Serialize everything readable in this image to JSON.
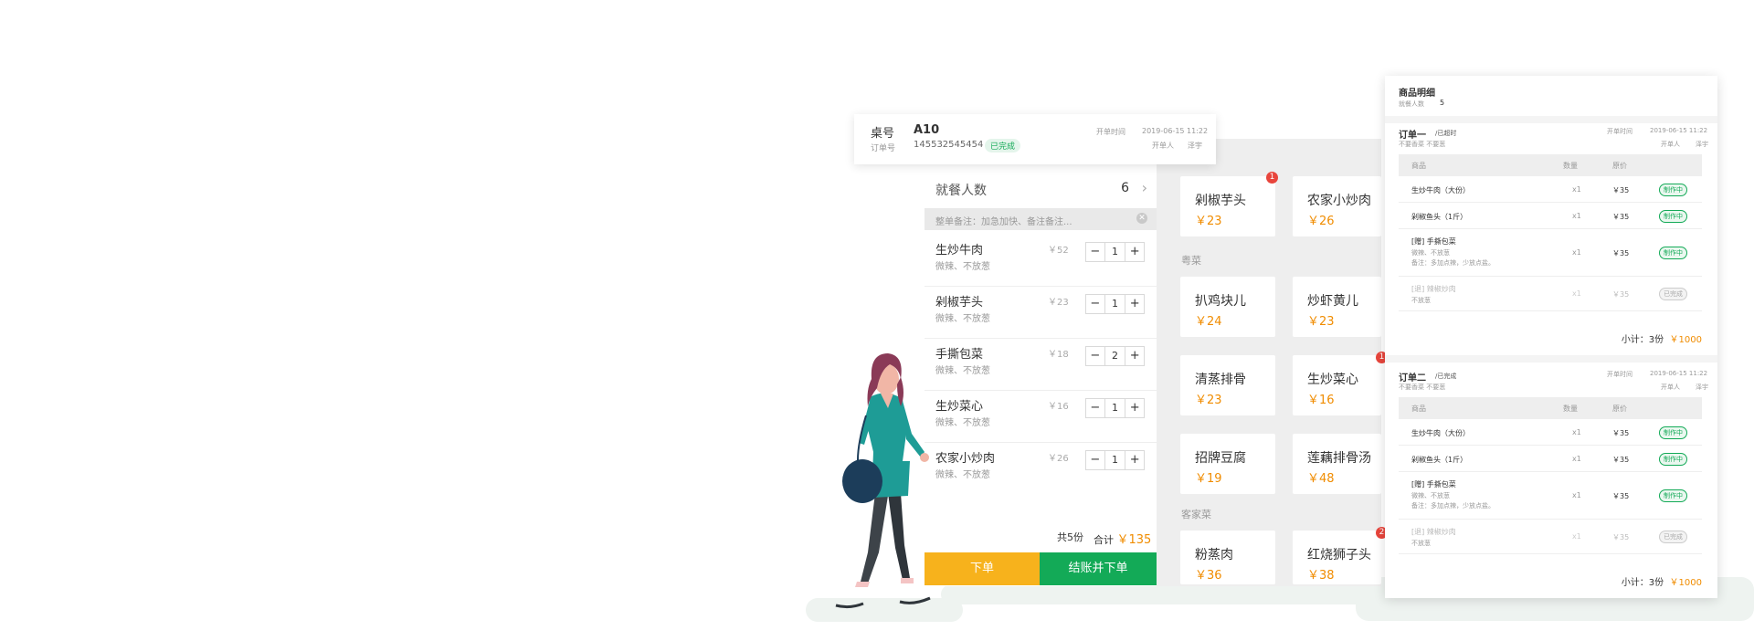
{
  "table_card": {
    "table_label": "桌号",
    "table_no": "A10",
    "order_label": "订单号",
    "order_no": "145532545454",
    "status": "已完成",
    "open_time_label": "开单时间",
    "open_time": "2019-06-15  11:22",
    "opener_label": "开单人",
    "opener": "泽宇"
  },
  "cart": {
    "diners_label": "就餐人数",
    "diners": "6",
    "remark_placeholder": "整单备注：加急加快、备注备注...",
    "items": [
      {
        "name": "生炒牛肉",
        "note": "微辣、不放葱",
        "price": "￥52",
        "qty": "1"
      },
      {
        "name": "剁椒芋头",
        "note": "微辣、不放葱",
        "price": "￥23",
        "qty": "1"
      },
      {
        "name": "手撕包菜",
        "note": "微辣、不放葱",
        "price": "￥18",
        "qty": "2"
      },
      {
        "name": "生炒菜心",
        "note": "微辣、不放葱",
        "price": "￥16",
        "qty": "1"
      },
      {
        "name": "农家小炒肉",
        "note": "微辣、不放葱",
        "price": "￥26",
        "qty": "1"
      }
    ],
    "count_text": "共5份",
    "total_label": "合计",
    "total": "￥135",
    "order_button": "下单",
    "pay_button": "结账并下单"
  },
  "menu": {
    "dishes_top": [
      {
        "name": "剁椒芋头",
        "price": "￥23",
        "badge": "1"
      },
      {
        "name": "农家小炒肉",
        "price": "￥26"
      }
    ],
    "cat_yue": "粤菜",
    "dishes_yue": [
      {
        "name": "扒鸡块儿",
        "price": "￥24"
      },
      {
        "name": "炒虾黄儿",
        "price": "￥23"
      },
      {
        "name": "清蒸排骨",
        "price": "￥23"
      },
      {
        "name": "生炒菜心",
        "price": "￥16",
        "badge": "1"
      },
      {
        "name": "招牌豆腐",
        "price": "￥19"
      },
      {
        "name": "莲藕排骨汤",
        "price": "￥48"
      }
    ],
    "cat_kejia": "客家菜",
    "dishes_kejia": [
      {
        "name": "粉蒸肉",
        "price": "￥36"
      },
      {
        "name": "红烧狮子头",
        "price": "￥38",
        "badge": "2"
      }
    ]
  },
  "detail": {
    "title": "商品明细",
    "diners_label": "就餐人数",
    "diners": "5",
    "col_item": "商品",
    "col_qty": "数量",
    "col_price": "原价",
    "orders": [
      {
        "name": "订单一",
        "tag": "/已超时",
        "sub": "不要香菜 不要葱",
        "time_label": "开单时间",
        "time": "2019-06-15  11:22",
        "opener_label": "开单人",
        "opener": "泽宇",
        "rows": [
          {
            "name": "生炒牛肉（大份）",
            "qty": "x1",
            "price": "￥35",
            "status": "制作中"
          },
          {
            "name": "剁椒鱼头（1斤）",
            "qty": "x1",
            "price": "￥35",
            "status": "制作中"
          },
          {
            "name": "[赠] 手撕包菜",
            "sub1": "微辣、不放葱",
            "sub2": "备注：多加点辣，少放点盐。",
            "qty": "x1",
            "price": "￥35",
            "status": "制作中"
          },
          {
            "name": "[退] 辣椒炒肉",
            "sub1": "不放葱",
            "qty": "x1",
            "price": "￥35",
            "status": "已完成"
          }
        ],
        "subtotal_label": "小计：3份",
        "subtotal": "￥1000"
      },
      {
        "name": "订单二",
        "tag": "/已完成",
        "sub": "不要香菜 不要葱",
        "time_label": "开单时间",
        "time": "2019-06-15  11:22",
        "opener_label": "开单人",
        "opener": "泽宇",
        "rows": [
          {
            "name": "生炒牛肉（大份）",
            "qty": "x1",
            "price": "￥35",
            "status": "制作中"
          },
          {
            "name": "剁椒鱼头（1斤）",
            "qty": "x1",
            "price": "￥35",
            "status": "制作中"
          },
          {
            "name": "[赠] 手撕包菜",
            "sub1": "微辣、不放葱",
            "sub2": "备注：多加点辣，少放点盐。",
            "qty": "x1",
            "price": "￥35",
            "status": "制作中"
          },
          {
            "name": "[退] 辣椒炒肉",
            "sub1": "不放葱",
            "qty": "x1",
            "price": "￥35",
            "status": "已完成"
          }
        ],
        "subtotal_label": "小计：3份",
        "subtotal": "￥1000"
      }
    ]
  }
}
